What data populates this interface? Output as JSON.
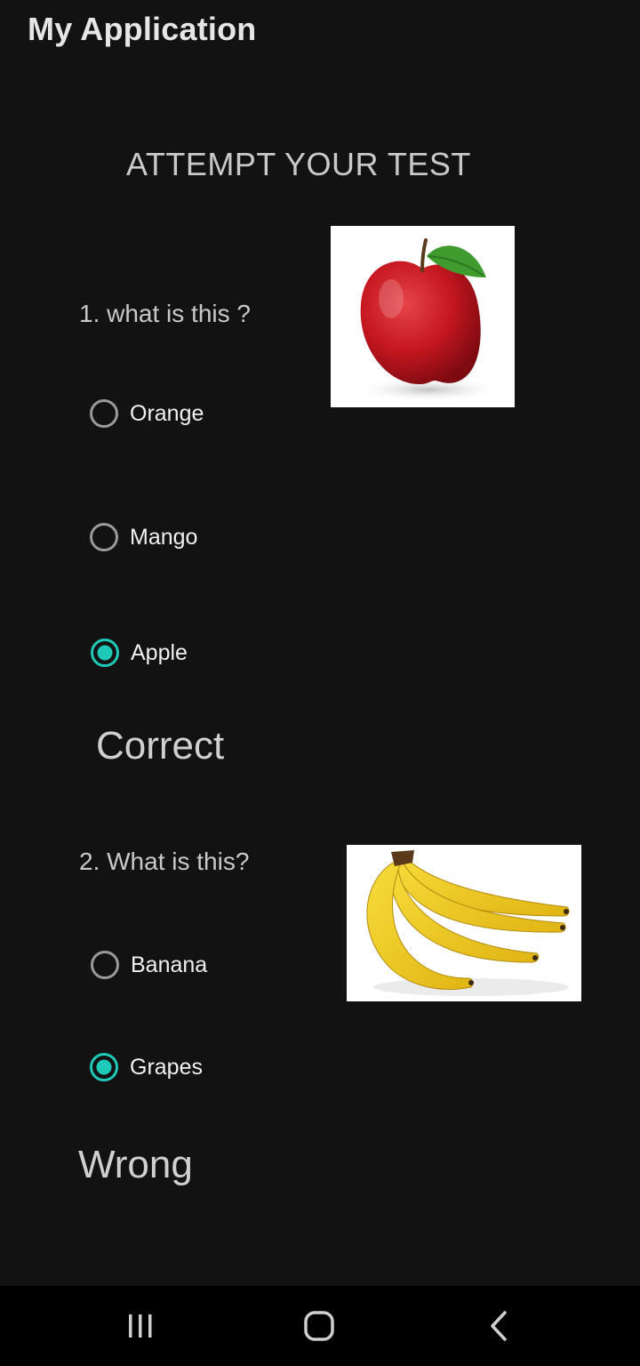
{
  "app": {
    "title": "My Application"
  },
  "heading": "ATTEMPT YOUR TEST",
  "questions": [
    {
      "text": "1. what is this ?",
      "image": "apple-image",
      "options": [
        {
          "label": "Orange",
          "checked": false
        },
        {
          "label": "Mango",
          "checked": false
        },
        {
          "label": "Apple",
          "checked": true
        }
      ],
      "result": "Correct"
    },
    {
      "text": "2. What is this?",
      "image": "banana-image",
      "options": [
        {
          "label": "Banana",
          "checked": false
        },
        {
          "label": "Grapes",
          "checked": true
        }
      ],
      "result": "Wrong"
    }
  ],
  "navbar": {
    "icons": [
      "recent-apps-icon",
      "home-icon",
      "back-icon"
    ]
  },
  "colors": {
    "background": "#121212",
    "accent": "#1ec9b8",
    "navbar": "#000000"
  }
}
